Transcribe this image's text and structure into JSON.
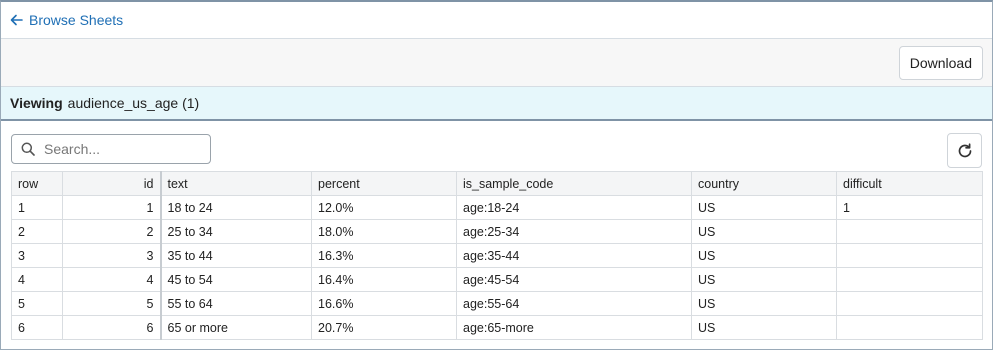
{
  "nav": {
    "back_label": "Browse Sheets"
  },
  "toolbar": {
    "download_label": "Download"
  },
  "viewing": {
    "prefix": "Viewing",
    "sheet": "audience_us_age (1)"
  },
  "search": {
    "placeholder": "Search..."
  },
  "table": {
    "columns": [
      "row",
      "id",
      "text",
      "percent",
      "is_sample_code",
      "country",
      "difficult"
    ],
    "rows": [
      [
        "1",
        "1",
        "18 to 24",
        "12.0%",
        "age:18-24",
        "US",
        "1"
      ],
      [
        "2",
        "2",
        "25 to 34",
        "18.0%",
        "age:25-34",
        "US",
        ""
      ],
      [
        "3",
        "3",
        "35 to 44",
        "16.3%",
        "age:35-44",
        "US",
        ""
      ],
      [
        "4",
        "4",
        "45 to 54",
        "16.4%",
        "age:45-54",
        "US",
        ""
      ],
      [
        "5",
        "5",
        "55 to 64",
        "16.6%",
        "age:55-64",
        "US",
        ""
      ],
      [
        "6",
        "6",
        "65 or more",
        "20.7%",
        "age:65-more",
        "US",
        ""
      ]
    ]
  },
  "colors": {
    "link": "#1f6fb5",
    "viewing_bg": "#e6f7fb"
  },
  "icons": {
    "back": "arrow-left-icon",
    "search": "search-icon",
    "refresh": "refresh-icon"
  }
}
